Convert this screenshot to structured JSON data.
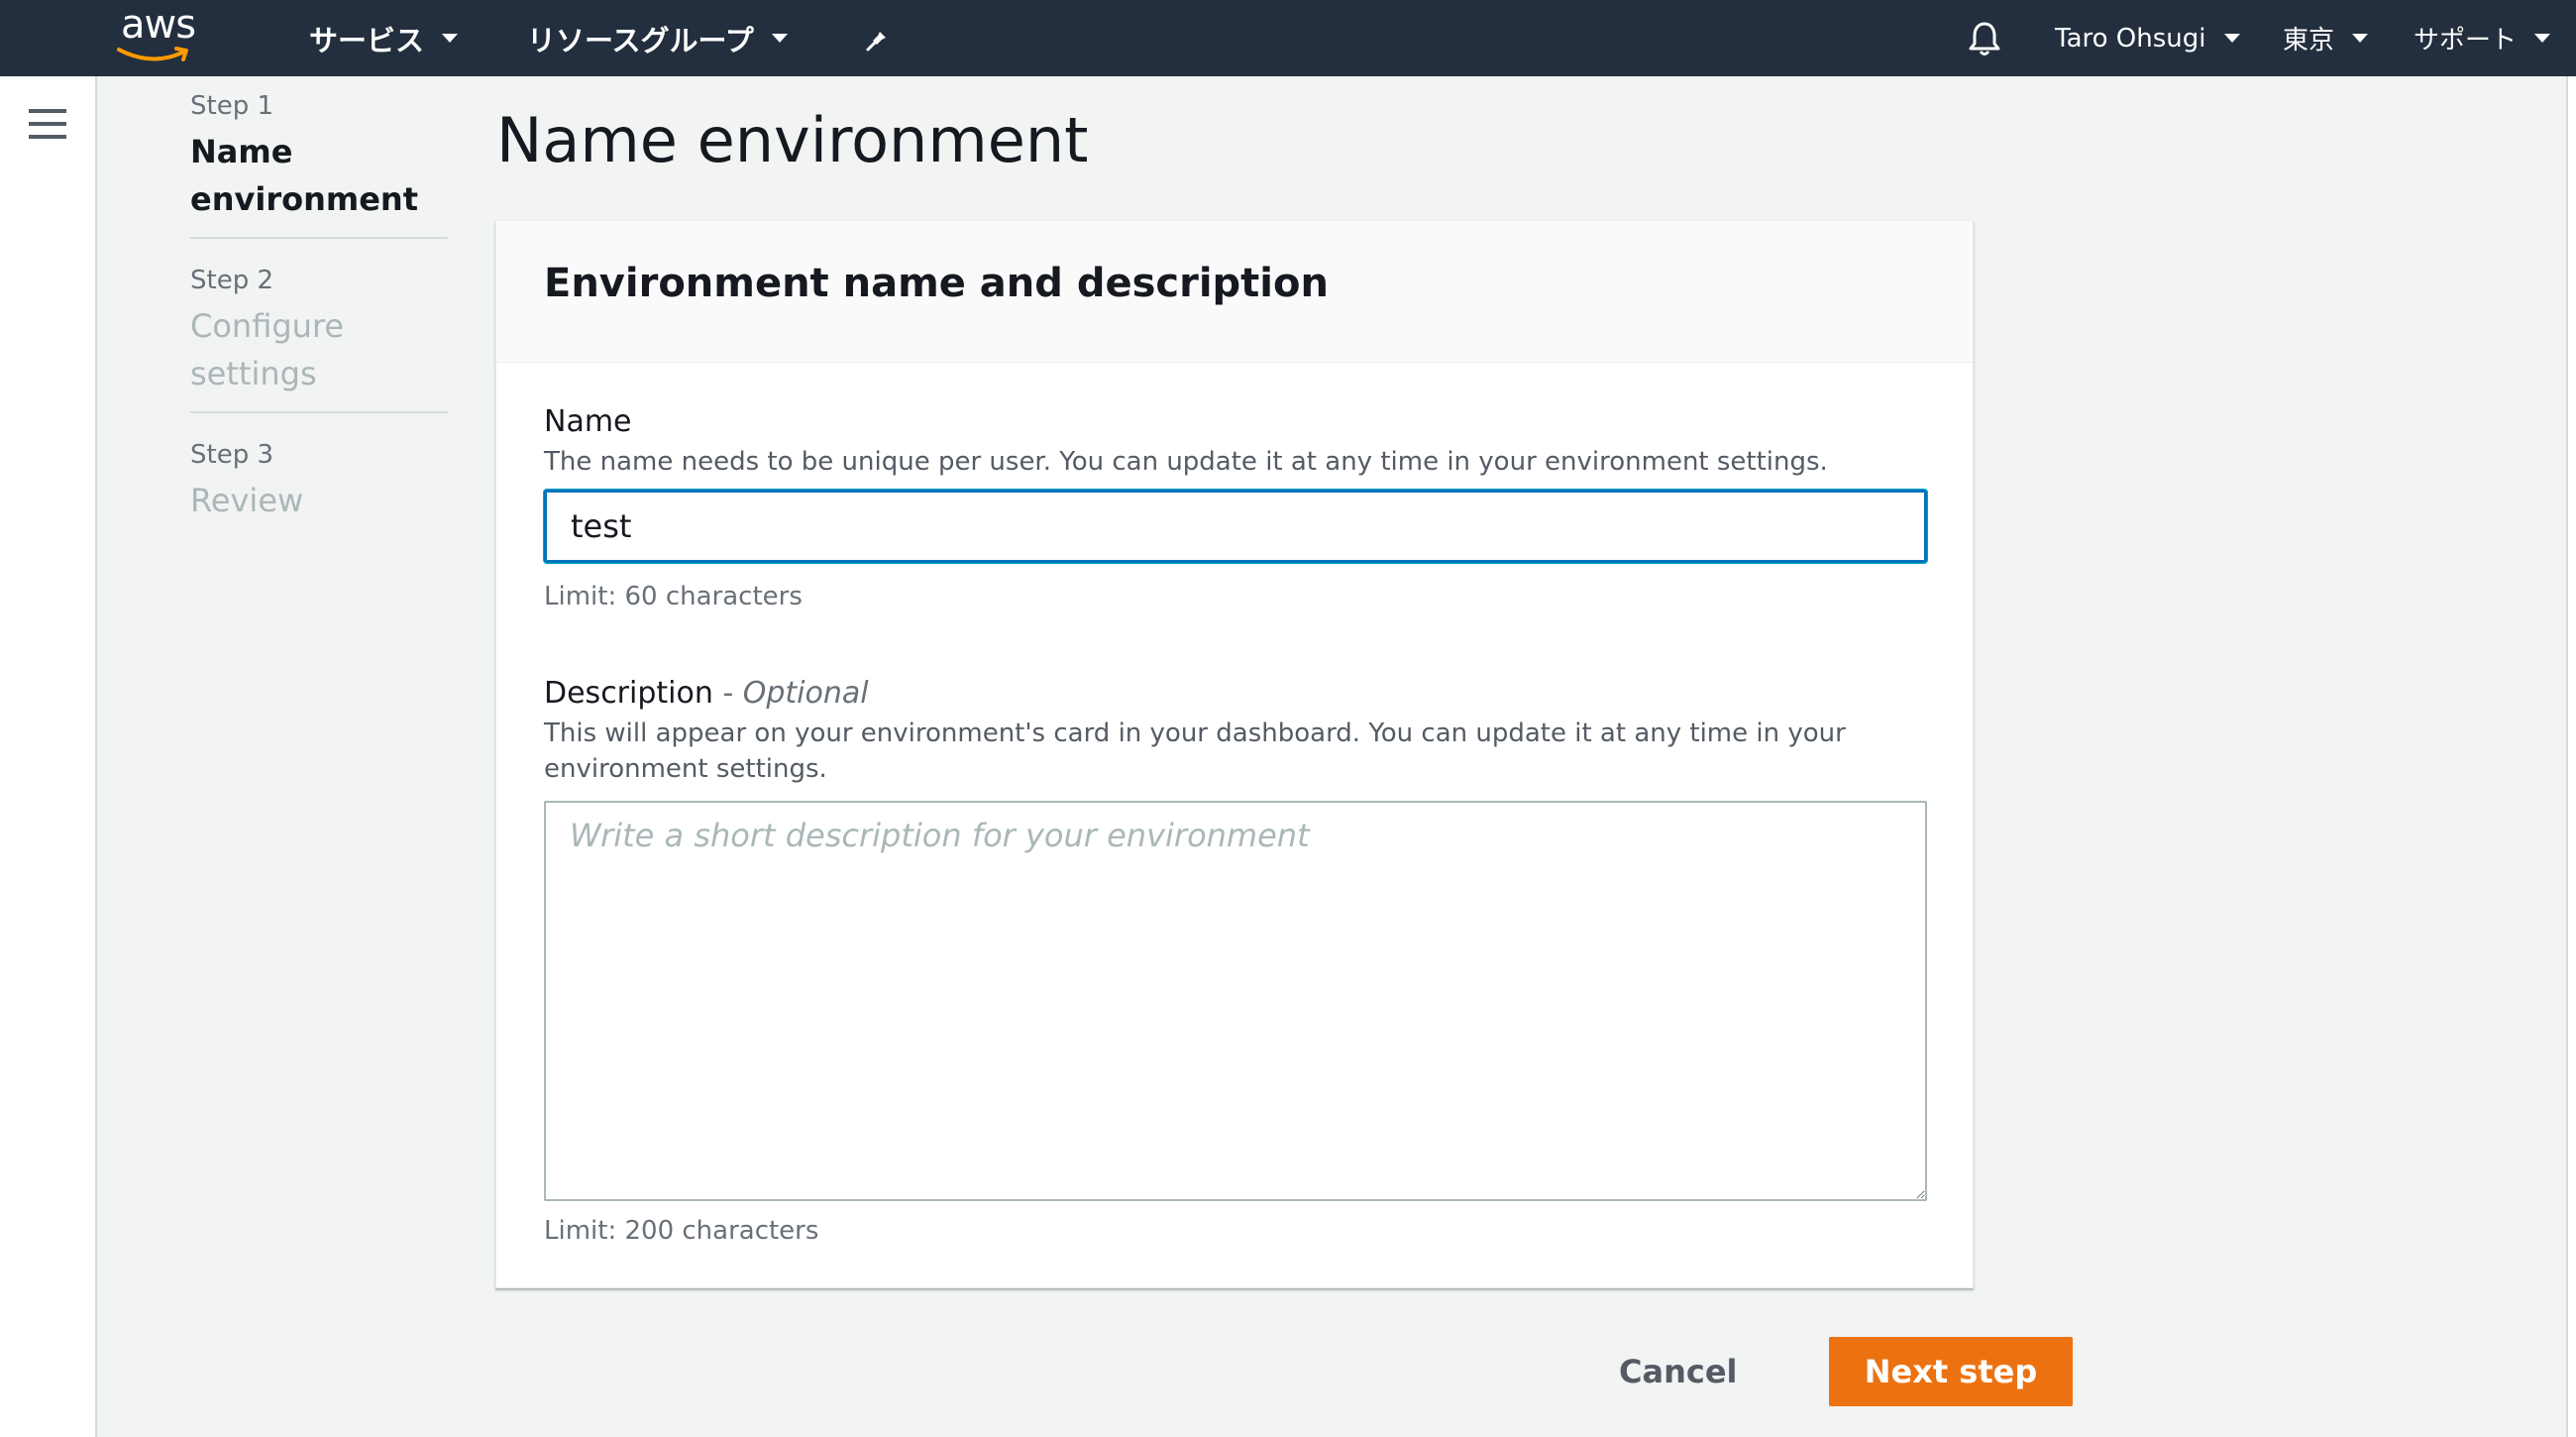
{
  "topbar": {
    "logo_text": "aws",
    "services_label": "サービス",
    "resource_groups_label": "リソースグループ",
    "user_label": "Taro Ohsugi",
    "region_label": "東京",
    "support_label": "サポート"
  },
  "steps": [
    {
      "number": "Step 1",
      "title": "Name environment",
      "active": true
    },
    {
      "number": "Step 2",
      "title": "Configure settings",
      "active": false
    },
    {
      "number": "Step 3",
      "title": "Review",
      "active": false
    }
  ],
  "page": {
    "title": "Name environment"
  },
  "card": {
    "title": "Environment name and description",
    "name": {
      "label": "Name",
      "description": "The name needs to be unique per user. You can update it at any time in your environment settings.",
      "value": "test",
      "limit": "Limit: 60 characters"
    },
    "description": {
      "label": "Description",
      "optional": "- Optional",
      "help": "This will appear on your environment's card in your dashboard. You can update it at any time in your environment settings.",
      "placeholder": "Write a short description for your environment",
      "limit": "Limit: 200 characters"
    }
  },
  "actions": {
    "cancel_label": "Cancel",
    "next_label": "Next step",
    "next_color": "#ec7211"
  },
  "icons": {
    "logo_smile": "amazon-smile-icon",
    "pin": "pin-icon",
    "bell": "bell-icon",
    "menu": "hamburger-menu-icon",
    "caret": "caret-down-icon"
  }
}
